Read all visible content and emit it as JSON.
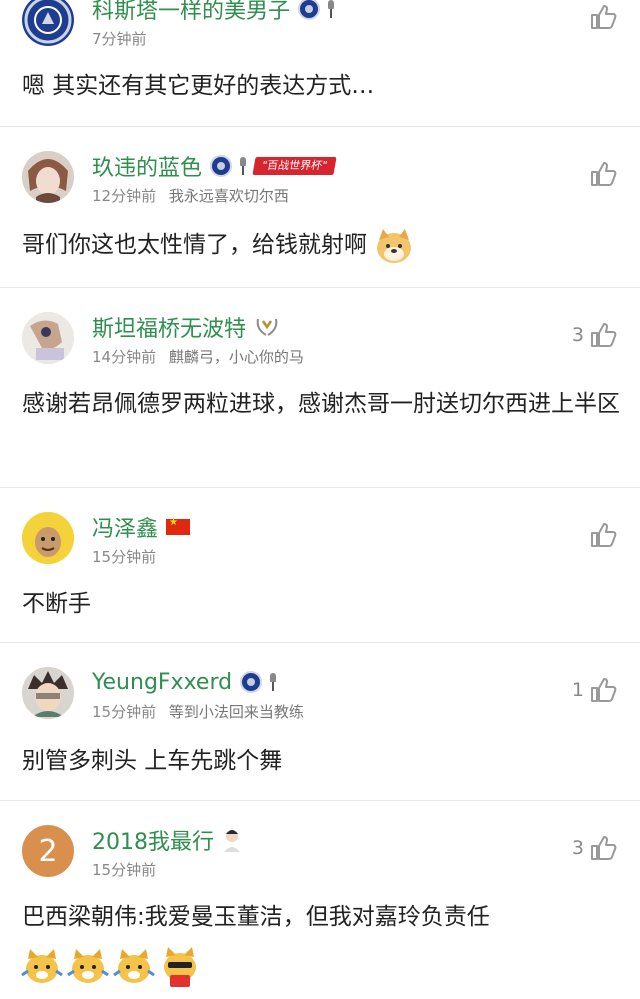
{
  "colors": {
    "username": "#2f8f4f",
    "meta": "#888888",
    "divider": "#e6e6e6"
  },
  "comments": [
    {
      "username": "科斯塔一样的美男子",
      "time": "7分钟前",
      "signature": "",
      "text": "嗯 其实还有其它更好的表达方式…",
      "likes": "",
      "avatar_icon": "chelsea-crest-avatar-icon",
      "badges": [
        "chelsea-badge-icon",
        "trophy-icon"
      ]
    },
    {
      "username": "玖违的蓝色",
      "time": "12分钟前",
      "signature": "我永远喜欢切尔西",
      "text": "哥们你这也太性情了，给钱就射啊",
      "likes": "",
      "avatar_icon": "anime-character-avatar-icon",
      "badges": [
        "chelsea-badge-icon",
        "trophy-icon",
        "banner-badge-icon"
      ],
      "banner_text": "\"百战世界杯\""
    },
    {
      "username": "斯坦福桥无波特",
      "time": "14分钟前",
      "signature": "麒麟弓，小心你的马",
      "text": "感谢若昂佩德罗两粒进球，感谢杰哥一肘送切尔西进上半区",
      "likes": "3",
      "avatar_icon": "hand-photo-avatar-icon",
      "badges": [
        "laurel-badge-icon"
      ]
    },
    {
      "username": "冯泽鑫",
      "time": "15分钟前",
      "signature": "",
      "text": "不断手",
      "likes": "",
      "avatar_icon": "yellow-hood-avatar-icon",
      "badges": [
        "china-flag-icon"
      ]
    },
    {
      "username": "YeungFxxerd",
      "time": "15分钟前",
      "signature": "等到小法回来当教练",
      "text": "别管多刺头 上车先跳个舞",
      "likes": "1",
      "avatar_icon": "cartoon-avatar-icon",
      "badges": [
        "chelsea-badge-icon",
        "trophy-icon"
      ]
    },
    {
      "username": "2018我最行",
      "time": "15分钟前",
      "signature": "",
      "text": "巴西梁朝伟:我爱曼玉董洁，但我对嘉玲负责任",
      "likes": "3",
      "avatar_icon": "letter-avatar-icon",
      "avatar_letter": "2",
      "badges": [
        "player-badge-icon"
      ]
    }
  ]
}
